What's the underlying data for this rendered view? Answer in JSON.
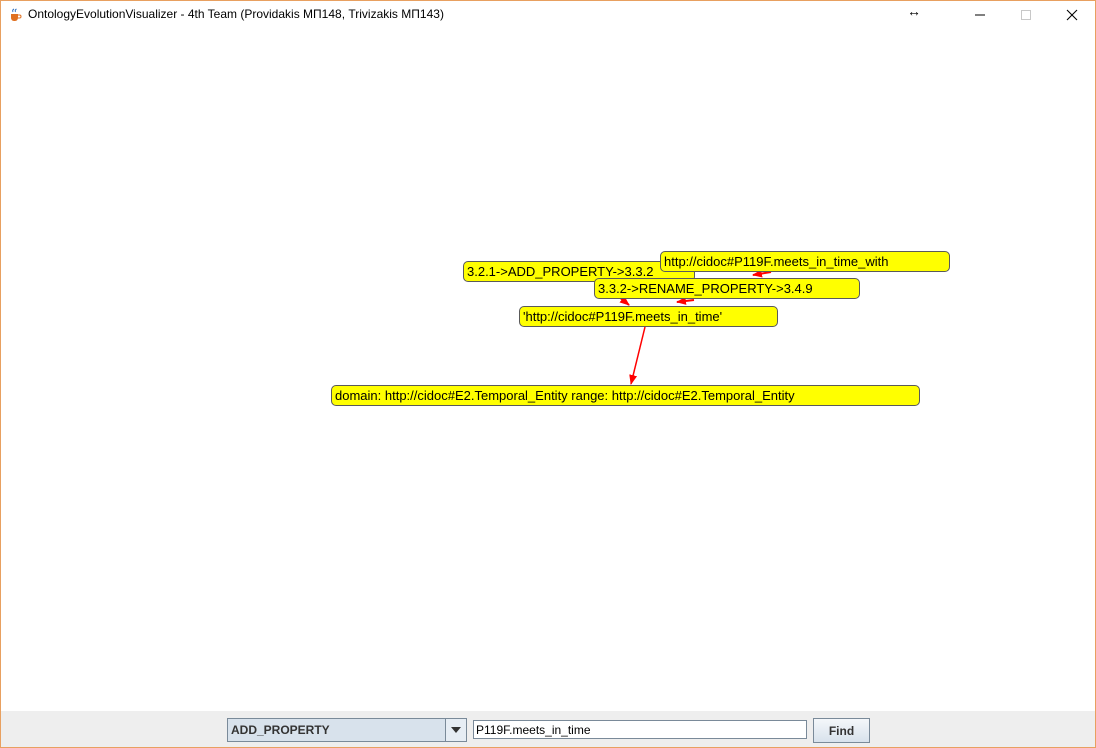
{
  "window": {
    "title": "OntologyEvolutionVisualizer - 4th Team (Providakis ΜΠ148, Trivizakis ΜΠ143)",
    "resize_glyph": "↔",
    "icons": {
      "app": "java-cup-icon",
      "minimize": "minimize-icon",
      "maximize": "maximize-icon",
      "close": "close-icon"
    }
  },
  "graph": {
    "nodes": [
      {
        "id": "n1",
        "label": "3.2.1->ADD_PROPERTY->3.3.2"
      },
      {
        "id": "n2",
        "label": "http://cidoc#P119F.meets_in_time_with"
      },
      {
        "id": "n3",
        "label": "3.3.2->RENAME_PROPERTY->3.4.9"
      },
      {
        "id": "n4",
        "label": "'http://cidoc#P119F.meets_in_time'"
      },
      {
        "id": "n5",
        "label": "domain: http://cidoc#E2.Temporal_Entity range: http://cidoc#E2.Temporal_Entity"
      }
    ],
    "node_color": "#ffff00",
    "edge_color": "#ff0000"
  },
  "toolbar": {
    "change_type_selected": "ADD_PROPERTY",
    "search_value": "P119F.meets_in_time",
    "find_label": "Find"
  }
}
